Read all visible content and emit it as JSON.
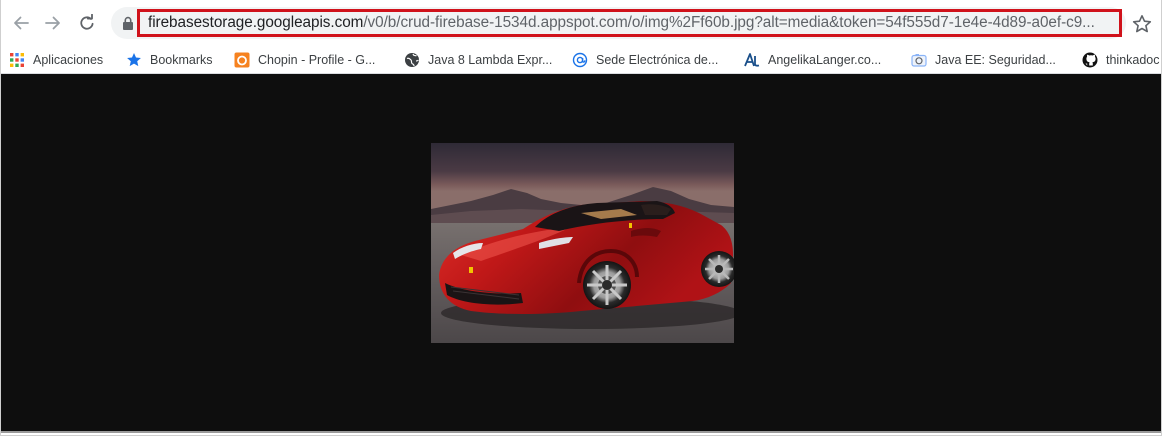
{
  "browser": {
    "url_host": "firebasestorage.googleapis.com",
    "url_path": "/v0/b/crud-firebase-1534d.appspot.com/o/img%2Ff60b.jpg?alt=media&token=54f555d7-1e4e-4d89-a0ef-c9...",
    "nav_icons": [
      "back-arrow-icon",
      "forward-arrow-icon",
      "reload-icon",
      "lock-icon",
      "star-icon"
    ],
    "highlight_color": "#d0121b"
  },
  "bookmarks": [
    {
      "label": "Aplicaciones",
      "icon": "apps-grid-icon"
    },
    {
      "label": "Bookmarks",
      "icon": "star-icon"
    },
    {
      "label": "Chopin - Profile - G...",
      "icon": "orange-square-icon"
    },
    {
      "label": "Java 8 Lambda Expr...",
      "icon": "globe-icon"
    },
    {
      "label": "Sede Electrónica de...",
      "icon": "at-sign-icon"
    },
    {
      "label": "AngelikaLanger.co...",
      "icon": "al-logo-icon"
    },
    {
      "label": "Java EE: Seguridad...",
      "icon": "camera-icon"
    },
    {
      "label": "thinkadoc",
      "icon": "github-icon"
    }
  ],
  "content": {
    "background": "#0e0e0e",
    "image": "red-sports-car-photo"
  }
}
